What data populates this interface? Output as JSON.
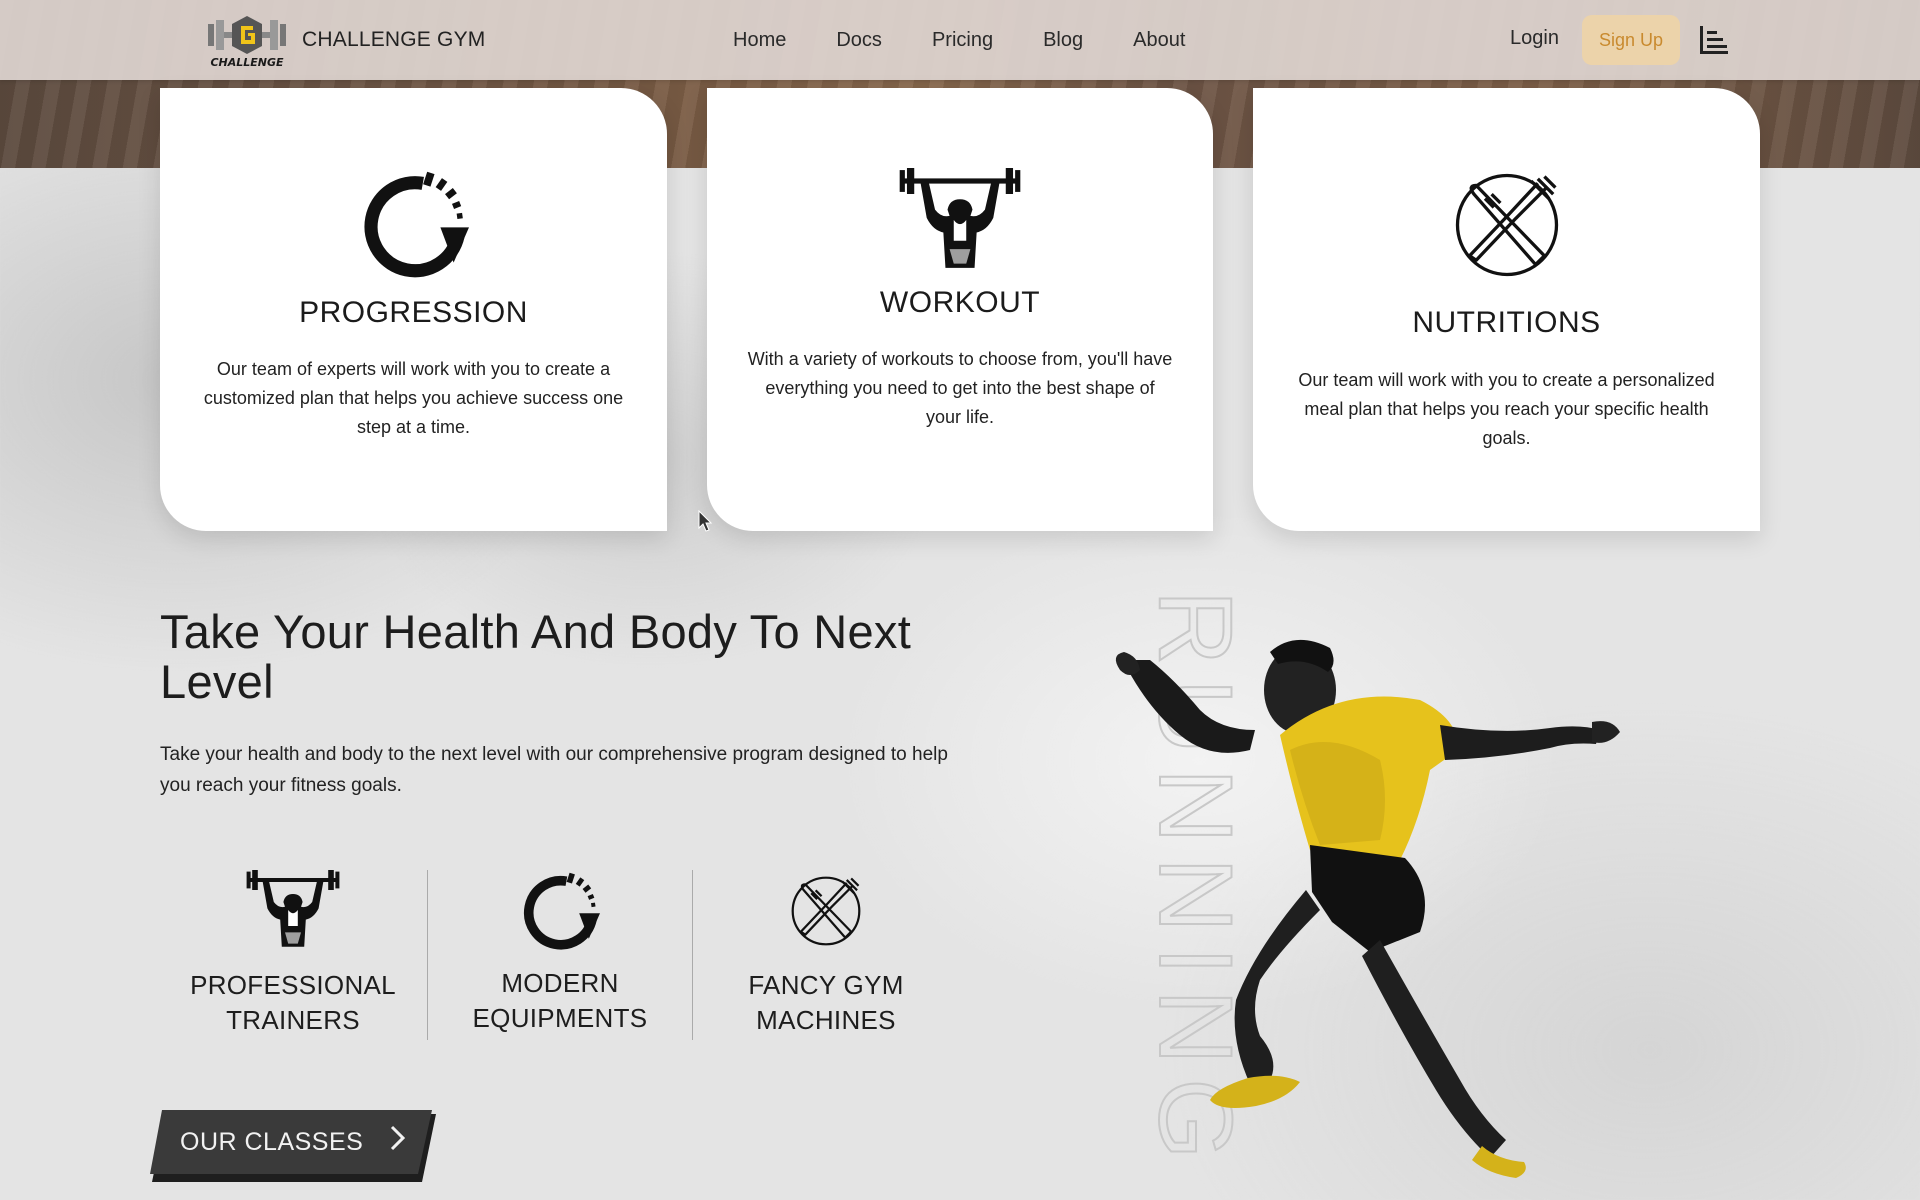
{
  "header": {
    "brand_name": "CHALLENGE GYM",
    "logo_text": "CHALLENGE",
    "nav": [
      "Home",
      "Docs",
      "Pricing",
      "Blog",
      "About"
    ],
    "login_label": "Login",
    "signup_label": "Sign Up",
    "menu_icon": "bar-chart-icon"
  },
  "cards": [
    {
      "icon": "progress-arrow-icon",
      "title": "PROGRESSION",
      "text": "Our team of experts will work with you to create a customized plan that helps you achieve success one step at a time."
    },
    {
      "icon": "weightlifter-icon",
      "title": "WORKOUT",
      "text": "With a variety of workouts to choose from, you'll have everything you need to get into the best shape of your life."
    },
    {
      "icon": "knife-fork-icon",
      "title": "NUTRITIONS",
      "text": "Our team will work with you to create a personalized meal plan that helps you reach your specific health goals."
    }
  ],
  "main": {
    "headline": "Take Your Health And Body To Next Level",
    "lead": "Take your health and body to the next level with our comprehensive program designed to help you reach your fitness goals.",
    "features": [
      {
        "icon": "weightlifter-icon",
        "line1": "PROFESSIONAL",
        "line2": "TRAINERS"
      },
      {
        "icon": "progress-arrow-icon",
        "line1": "MODERN",
        "line2": "EQUIPMENTS"
      },
      {
        "icon": "knife-fork-icon",
        "line1": "FANCY GYM",
        "line2": "MACHINES"
      }
    ],
    "cta_label": "OUR CLASSES",
    "vertical_text": "RUNNING"
  },
  "colors": {
    "accent": "#ecd3aa",
    "accent_text": "#c98a2e",
    "runner_shirt": "#e6c21c",
    "button_dark": "#3a3a3a"
  }
}
